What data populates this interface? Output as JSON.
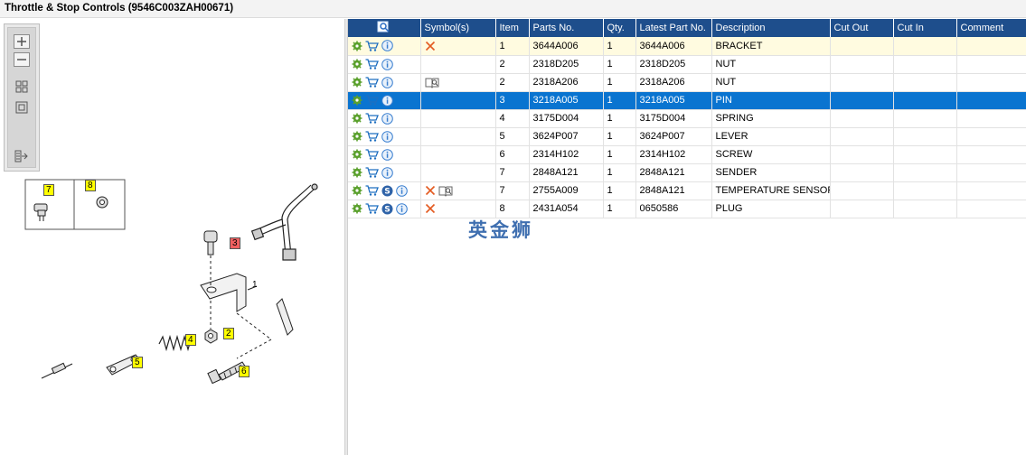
{
  "window": {
    "title": "Throttle & Stop Controls (9546C003ZAH00671)"
  },
  "toolbox": {
    "buttons": [
      {
        "name": "zoom-in-icon"
      },
      {
        "name": "zoom-out-icon"
      },
      {
        "name": "grid-view-icon"
      },
      {
        "name": "fit-view-icon"
      },
      {
        "name": "export-icon"
      }
    ]
  },
  "diagram": {
    "callouts": [
      "7",
      "8",
      "3",
      "1",
      "2",
      "4",
      "5",
      "6"
    ]
  },
  "grid": {
    "columns": [
      "",
      "Symbol(s)",
      "Item",
      "Parts No.",
      "Qty.",
      "Latest Part No.",
      "Description",
      "Cut Out",
      "Cut In",
      "Comment"
    ],
    "rows": [
      {
        "icons": [
          "gear-icon",
          "cart-icon",
          "info-icon"
        ],
        "symbols": [
          "x-mark-icon"
        ],
        "item": "1",
        "part": "3644A006",
        "qty": "1",
        "latest": "3644A006",
        "desc": "BRACKET",
        "cut_out": "",
        "cut_in": "",
        "comment": "",
        "state": "highlight"
      },
      {
        "icons": [
          "gear-icon",
          "cart-icon",
          "info-icon"
        ],
        "symbols": [],
        "item": "2",
        "part": "2318D205",
        "qty": "1",
        "latest": "2318D205",
        "desc": "NUT",
        "cut_out": "",
        "cut_in": "",
        "comment": "",
        "state": ""
      },
      {
        "icons": [
          "gear-icon",
          "cart-icon",
          "info-icon"
        ],
        "symbols": [
          "book-icon"
        ],
        "item": "2",
        "part": "2318A206",
        "qty": "1",
        "latest": "2318A206",
        "desc": "NUT",
        "cut_out": "",
        "cut_in": "",
        "comment": "",
        "state": ""
      },
      {
        "icons": [
          "gear-icon",
          "cart-icon",
          "info-icon"
        ],
        "symbols": [],
        "item": "3",
        "part": "3218A005",
        "qty": "1",
        "latest": "3218A005",
        "desc": "PIN",
        "cut_out": "",
        "cut_in": "",
        "comment": "",
        "state": "selected"
      },
      {
        "icons": [
          "gear-icon",
          "cart-icon",
          "info-icon"
        ],
        "symbols": [],
        "item": "4",
        "part": "3175D004",
        "qty": "1",
        "latest": "3175D004",
        "desc": "SPRING",
        "cut_out": "",
        "cut_in": "",
        "comment": "",
        "state": ""
      },
      {
        "icons": [
          "gear-icon",
          "cart-icon",
          "info-icon"
        ],
        "symbols": [],
        "item": "5",
        "part": "3624P007",
        "qty": "1",
        "latest": "3624P007",
        "desc": "LEVER",
        "cut_out": "",
        "cut_in": "",
        "comment": "",
        "state": ""
      },
      {
        "icons": [
          "gear-icon",
          "cart-icon",
          "info-icon"
        ],
        "symbols": [],
        "item": "6",
        "part": "2314H102",
        "qty": "1",
        "latest": "2314H102",
        "desc": "SCREW",
        "cut_out": "",
        "cut_in": "",
        "comment": "",
        "state": ""
      },
      {
        "icons": [
          "gear-icon",
          "cart-icon",
          "info-icon"
        ],
        "symbols": [],
        "item": "7",
        "part": "2848A121",
        "qty": "1",
        "latest": "2848A121",
        "desc": "SENDER",
        "cut_out": "",
        "cut_in": "",
        "comment": "",
        "state": ""
      },
      {
        "icons": [
          "gear-icon",
          "cart-icon",
          "s-badge-icon",
          "info-icon"
        ],
        "symbols": [
          "x-mark-icon",
          "book-icon"
        ],
        "item": "7",
        "part": "2755A009",
        "qty": "1",
        "latest": "2848A121",
        "desc": "TEMPERATURE SENSOR",
        "cut_out": "",
        "cut_in": "",
        "comment": "",
        "state": ""
      },
      {
        "icons": [
          "gear-icon",
          "cart-icon",
          "s-badge-icon",
          "info-icon"
        ],
        "symbols": [
          "x-mark-icon"
        ],
        "item": "8",
        "part": "2431A054",
        "qty": "1",
        "latest": "0650586",
        "desc": "PLUG",
        "cut_out": "",
        "cut_in": "",
        "comment": "",
        "state": ""
      }
    ]
  },
  "watermark": {
    "text": "英金狮"
  },
  "colors": {
    "header": "#1e4e8c",
    "selected": "#0a74d0",
    "highlight": "#fffbe0",
    "callout_yellow": "#ffff00",
    "callout_red": "#f06060"
  }
}
